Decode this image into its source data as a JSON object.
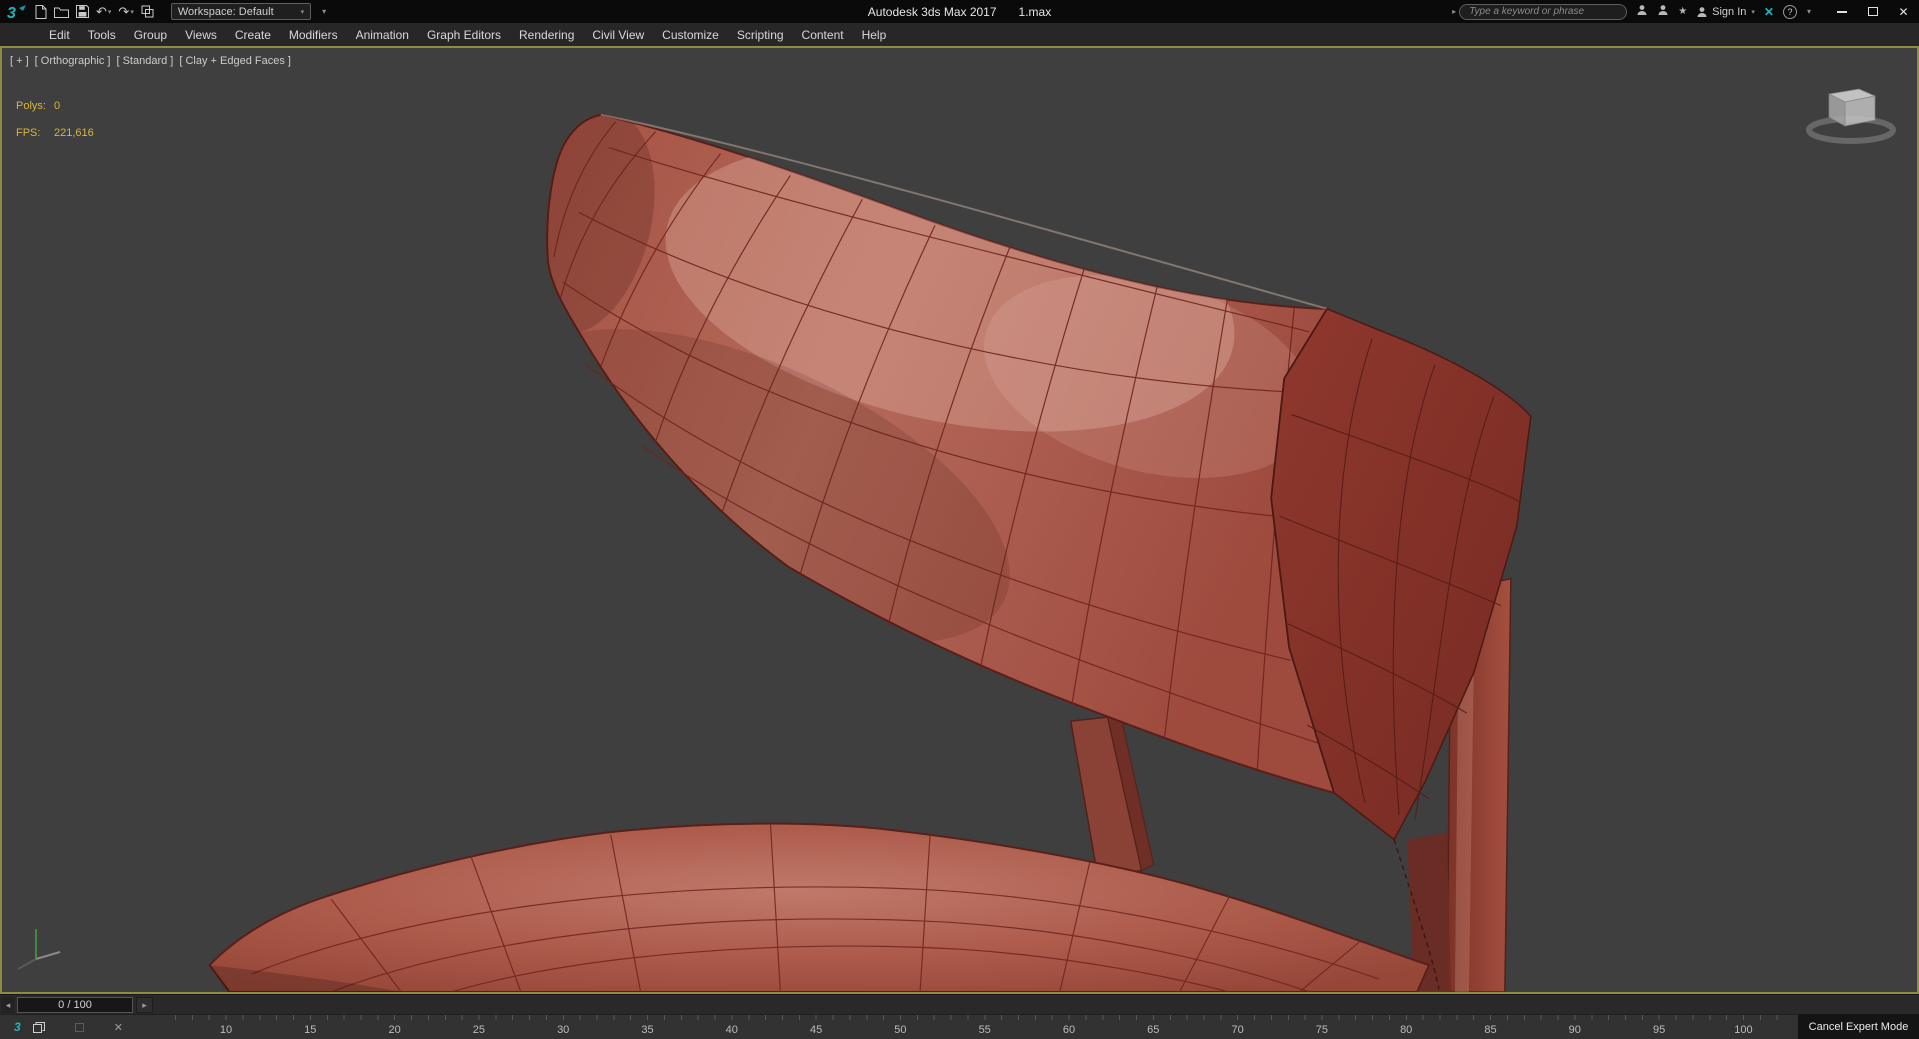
{
  "title_bar": {
    "workspace": "Workspace: Default",
    "title": "Autodesk 3ds Max 2017",
    "file": "1.max",
    "search_placeholder": "Type a keyword or phrase",
    "sign_in": "Sign In"
  },
  "menu_bar": {
    "items": [
      "Edit",
      "Tools",
      "Group",
      "Views",
      "Create",
      "Modifiers",
      "Animation",
      "Graph Editors",
      "Rendering",
      "Civil View",
      "Customize",
      "Scripting",
      "Content",
      "Help"
    ]
  },
  "viewport": {
    "labels": {
      "plus": "[ + ]",
      "view": "[ Orthographic ]",
      "standard": "[ Standard ]",
      "shading": "[ Clay + Edged Faces ]"
    },
    "stats": {
      "polys_label": "Polys:",
      "polys_value": "0",
      "fps_label": "FPS:",
      "fps_value": "221,616"
    }
  },
  "timeline": {
    "slider_value": "0 / 100",
    "tick_labels": [
      "10",
      "15",
      "20",
      "25",
      "30",
      "35",
      "40",
      "45",
      "50",
      "55",
      "60",
      "65",
      "70",
      "75",
      "80",
      "85",
      "90",
      "95",
      "100"
    ]
  },
  "status": {
    "cancel_expert_label": "Cancel Expert Mode"
  },
  "colors": {
    "viewport_border": "#8d8d42",
    "stats_yellow": "#d9b63b",
    "clay_base": "#ad5a4c",
    "clay_dark_cap": "#85332a",
    "wireframe": "#6e241c",
    "logo_teal": "#1fb6c4"
  },
  "glyphs": {
    "undo": "↶",
    "redo": "↷",
    "caret": "▾",
    "left_arrow": "◂",
    "right_arrow": "▸",
    "close": "✕",
    "help": "?",
    "star": "★",
    "exchange": "✕",
    "tray_close": "✕",
    "search_arrow": "▸"
  }
}
